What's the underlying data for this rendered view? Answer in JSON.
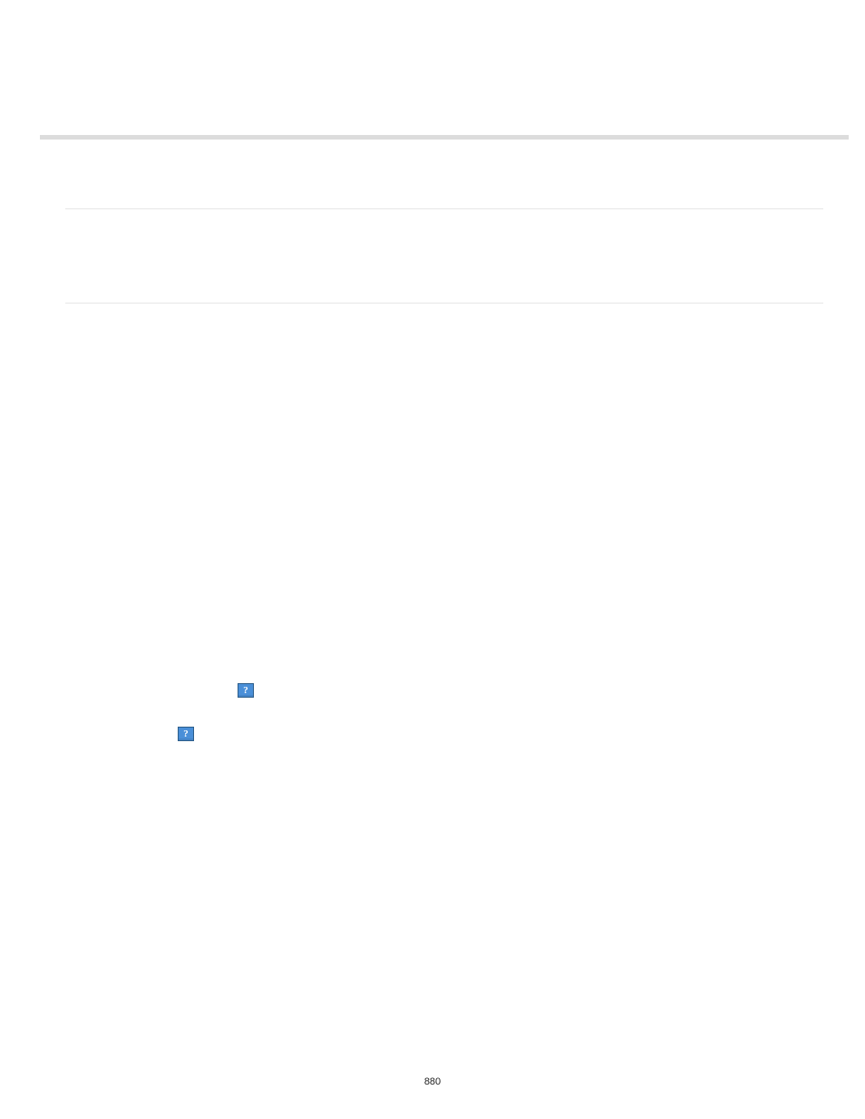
{
  "page": {
    "number": "880"
  },
  "icons": {
    "question_mark": "?"
  }
}
